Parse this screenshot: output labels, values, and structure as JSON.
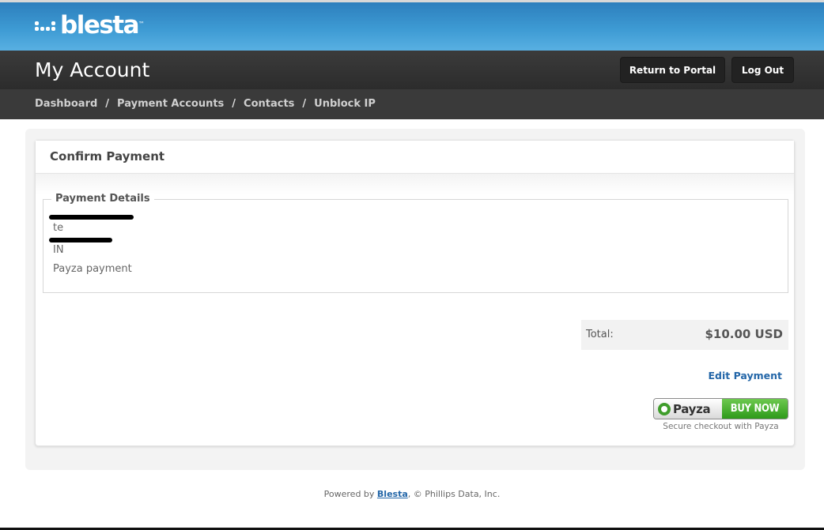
{
  "brand": {
    "logo_text": "blesta",
    "trademark": "™"
  },
  "header": {
    "title": "My Account",
    "buttons": {
      "portal": "Return to Portal",
      "logout": "Log Out"
    }
  },
  "nav": {
    "items": [
      {
        "label": "Dashboard"
      },
      {
        "label": "Payment Accounts"
      },
      {
        "label": "Contacts"
      },
      {
        "label": "Unblock IP"
      }
    ],
    "separator": "/"
  },
  "card": {
    "title": "Confirm Payment",
    "details": {
      "legend": "Payment Details",
      "lines": [
        "te",
        "IN"
      ],
      "method": "Payza payment"
    },
    "total": {
      "label": "Total:",
      "value": "$10.00 USD"
    },
    "edit_link": "Edit Payment",
    "payza": {
      "brand": "Payza",
      "action": "BUY NOW",
      "secure_text": "Secure checkout with Payza"
    }
  },
  "footer": {
    "prefix": "Powered by ",
    "link": "Blesta",
    "suffix": ", © Phillips Data, Inc."
  },
  "colors": {
    "header_blue": "#3d9ad3",
    "dark_bar": "#2c2c2c",
    "link_blue": "#2366a8",
    "payza_green": "#3f9d2b"
  }
}
